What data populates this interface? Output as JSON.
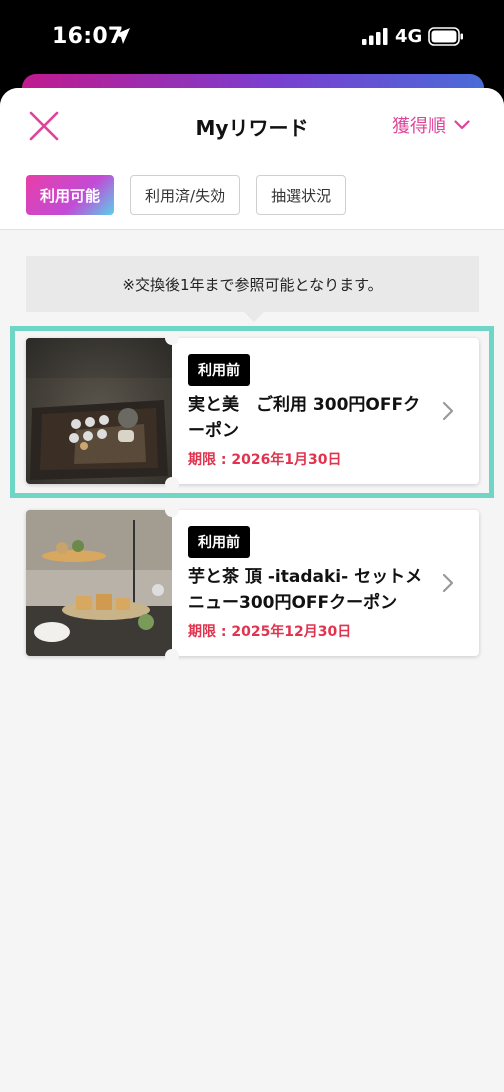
{
  "status_bar": {
    "time": "16:07",
    "network": "4G",
    "icons": [
      "location-arrow-icon",
      "signal-icon",
      "battery-icon"
    ]
  },
  "header": {
    "title": "Myリワード",
    "sort_label": "獲得順",
    "close_icon": "close-icon",
    "accent_color": "#e0449a"
  },
  "tabs": [
    {
      "label": "利用可能",
      "active": true
    },
    {
      "label": "利用済/失効",
      "active": false
    },
    {
      "label": "抽選状況",
      "active": false
    }
  ],
  "notice": "※交換後1年まで参照可能となります。",
  "coupons": [
    {
      "status": "利用前",
      "title": "実と美　ご利用 300円OFFクーポン",
      "expiry": "期限 : 2026年1月30日",
      "highlighted": true,
      "image": "tea-set-photo"
    },
    {
      "status": "利用前",
      "title": "芋と茶 頂 -itadaki- セットメニュー300円OFFクーポン",
      "expiry": "期限 : 2025年12月30日",
      "highlighted": false,
      "image": "afternoon-tea-photo"
    }
  ],
  "colors": {
    "highlight_border": "#6fd6c5",
    "expiry_red": "#e0334e",
    "tab_gradient_start": "#e83ea8",
    "tab_gradient_end": "#5ad0ea"
  }
}
